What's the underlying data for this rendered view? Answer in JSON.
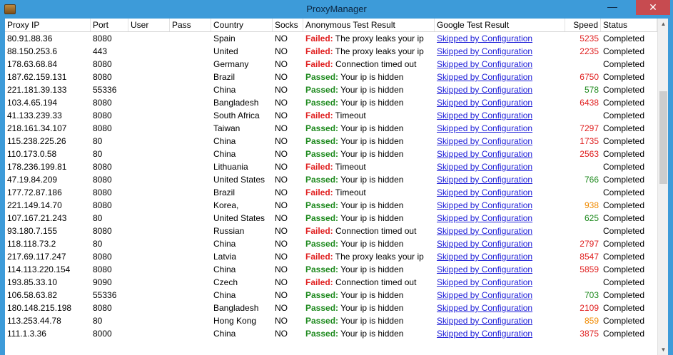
{
  "window": {
    "title": "ProxyManager",
    "minimize_glyph": "—",
    "close_glyph": "✕"
  },
  "columns": [
    "Proxy IP",
    "Port",
    "User",
    "Pass",
    "Country",
    "Socks",
    "Anonymous Test Result",
    "Google Test Result",
    "Speed",
    "Status"
  ],
  "link_text": "Skipped by Configuration",
  "colors": {
    "failed": "#e02020",
    "passed": "#1e8a1e",
    "link": "#2020d8",
    "speed_red": "#e02020",
    "speed_green": "#1e8a1e",
    "speed_orange": "#f08a00",
    "titlebar": "#3d9bd9",
    "close": "#c74b50"
  },
  "rows": [
    {
      "ip": "80.91.88.36",
      "port": "8080",
      "user": "",
      "pass": "",
      "country": "Spain",
      "socks": "NO",
      "anon_status": "Failed:",
      "anon_text": " The proxy leaks your ip",
      "google": "Skipped by Configuration",
      "speed": "5235",
      "speed_color": "red",
      "status": "Completed"
    },
    {
      "ip": "88.150.253.6",
      "port": "443",
      "user": "",
      "pass": "",
      "country": "United",
      "socks": "NO",
      "anon_status": "Failed:",
      "anon_text": " The proxy leaks your ip",
      "google": "Skipped by Configuration",
      "speed": "2235",
      "speed_color": "red",
      "status": "Completed"
    },
    {
      "ip": "178.63.68.84",
      "port": "8080",
      "user": "",
      "pass": "",
      "country": "Germany",
      "socks": "NO",
      "anon_status": "Failed:",
      "anon_text": " Connection timed out",
      "google": "Skipped by Configuration",
      "speed": "",
      "speed_color": "",
      "status": "Completed"
    },
    {
      "ip": "187.62.159.131",
      "port": "8080",
      "user": "",
      "pass": "",
      "country": "Brazil",
      "socks": "NO",
      "anon_status": "Passed:",
      "anon_text": " Your ip is hidden",
      "google": "Skipped by Configuration",
      "speed": "6750",
      "speed_color": "red",
      "status": "Completed"
    },
    {
      "ip": "221.181.39.133",
      "port": "55336",
      "user": "",
      "pass": "",
      "country": "China",
      "socks": "NO",
      "anon_status": "Passed:",
      "anon_text": " Your ip is hidden",
      "google": "Skipped by Configuration",
      "speed": "578",
      "speed_color": "green",
      "status": "Completed"
    },
    {
      "ip": "103.4.65.194",
      "port": "8080",
      "user": "",
      "pass": "",
      "country": "Bangladesh",
      "socks": "NO",
      "anon_status": "Passed:",
      "anon_text": " Your ip is hidden",
      "google": "Skipped by Configuration",
      "speed": "6438",
      "speed_color": "red",
      "status": "Completed"
    },
    {
      "ip": "41.133.239.33",
      "port": "8080",
      "user": "",
      "pass": "",
      "country": "South Africa",
      "socks": "NO",
      "anon_status": "Failed:",
      "anon_text": " Timeout",
      "google": "Skipped by Configuration",
      "speed": "",
      "speed_color": "",
      "status": "Completed"
    },
    {
      "ip": "218.161.34.107",
      "port": "8080",
      "user": "",
      "pass": "",
      "country": "Taiwan",
      "socks": "NO",
      "anon_status": "Passed:",
      "anon_text": " Your ip is hidden",
      "google": "Skipped by Configuration",
      "speed": "7297",
      "speed_color": "red",
      "status": "Completed"
    },
    {
      "ip": "115.238.225.26",
      "port": "80",
      "user": "",
      "pass": "",
      "country": "China",
      "socks": "NO",
      "anon_status": "Passed:",
      "anon_text": " Your ip is hidden",
      "google": "Skipped by Configuration",
      "speed": "1735",
      "speed_color": "red",
      "status": "Completed"
    },
    {
      "ip": "110.173.0.58",
      "port": "80",
      "user": "",
      "pass": "",
      "country": "China",
      "socks": "NO",
      "anon_status": "Passed:",
      "anon_text": " Your ip is hidden",
      "google": "Skipped by Configuration",
      "speed": "2563",
      "speed_color": "red",
      "status": "Completed"
    },
    {
      "ip": "178.236.199.81",
      "port": "8080",
      "user": "",
      "pass": "",
      "country": "Lithuania",
      "socks": "NO",
      "anon_status": "Failed:",
      "anon_text": " Timeout",
      "google": "Skipped by Configuration",
      "speed": "",
      "speed_color": "",
      "status": "Completed"
    },
    {
      "ip": "47.19.84.209",
      "port": "8080",
      "user": "",
      "pass": "",
      "country": "United States",
      "socks": "NO",
      "anon_status": "Passed:",
      "anon_text": " Your ip is hidden",
      "google": "Skipped by Configuration",
      "speed": "766",
      "speed_color": "green",
      "status": "Completed"
    },
    {
      "ip": "177.72.87.186",
      "port": "8080",
      "user": "",
      "pass": "",
      "country": "Brazil",
      "socks": "NO",
      "anon_status": "Failed:",
      "anon_text": " Timeout",
      "google": "Skipped by Configuration",
      "speed": "",
      "speed_color": "",
      "status": "Completed"
    },
    {
      "ip": "221.149.14.70",
      "port": "8080",
      "user": "",
      "pass": "",
      "country": "Korea,",
      "socks": "NO",
      "anon_status": "Passed:",
      "anon_text": " Your ip is hidden",
      "google": "Skipped by Configuration",
      "speed": "938",
      "speed_color": "orange",
      "status": "Completed"
    },
    {
      "ip": "107.167.21.243",
      "port": "80",
      "user": "",
      "pass": "",
      "country": "United States",
      "socks": "NO",
      "anon_status": "Passed:",
      "anon_text": " Your ip is hidden",
      "google": "Skipped by Configuration",
      "speed": "625",
      "speed_color": "green",
      "status": "Completed"
    },
    {
      "ip": "93.180.7.155",
      "port": "8080",
      "user": "",
      "pass": "",
      "country": "Russian",
      "socks": "NO",
      "anon_status": "Failed:",
      "anon_text": " Connection timed out",
      "google": "Skipped by Configuration",
      "speed": "",
      "speed_color": "",
      "status": "Completed"
    },
    {
      "ip": "118.118.73.2",
      "port": "80",
      "user": "",
      "pass": "",
      "country": "China",
      "socks": "NO",
      "anon_status": "Passed:",
      "anon_text": " Your ip is hidden",
      "google": "Skipped by Configuration",
      "speed": "2797",
      "speed_color": "red",
      "status": "Completed"
    },
    {
      "ip": "217.69.117.247",
      "port": "8080",
      "user": "",
      "pass": "",
      "country": "Latvia",
      "socks": "NO",
      "anon_status": "Failed:",
      "anon_text": " The proxy leaks your ip",
      "google": "Skipped by Configuration",
      "speed": "8547",
      "speed_color": "red",
      "status": "Completed"
    },
    {
      "ip": "114.113.220.154",
      "port": "8080",
      "user": "",
      "pass": "",
      "country": "China",
      "socks": "NO",
      "anon_status": "Passed:",
      "anon_text": " Your ip is hidden",
      "google": "Skipped by Configuration",
      "speed": "5859",
      "speed_color": "red",
      "status": "Completed"
    },
    {
      "ip": "193.85.33.10",
      "port": "9090",
      "user": "",
      "pass": "",
      "country": "Czech",
      "socks": "NO",
      "anon_status": "Failed:",
      "anon_text": " Connection timed out",
      "google": "Skipped by Configuration",
      "speed": "",
      "speed_color": "",
      "status": "Completed"
    },
    {
      "ip": "106.58.63.82",
      "port": "55336",
      "user": "",
      "pass": "",
      "country": "China",
      "socks": "NO",
      "anon_status": "Passed:",
      "anon_text": " Your ip is hidden",
      "google": "Skipped by Configuration",
      "speed": "703",
      "speed_color": "green",
      "status": "Completed"
    },
    {
      "ip": "180.148.215.198",
      "port": "8080",
      "user": "",
      "pass": "",
      "country": "Bangladesh",
      "socks": "NO",
      "anon_status": "Passed:",
      "anon_text": " Your ip is hidden",
      "google": "Skipped by Configuration",
      "speed": "2109",
      "speed_color": "red",
      "status": "Completed"
    },
    {
      "ip": "113.253.44.78",
      "port": "80",
      "user": "",
      "pass": "",
      "country": "Hong Kong",
      "socks": "NO",
      "anon_status": "Passed:",
      "anon_text": " Your ip is hidden",
      "google": "Skipped by Configuration",
      "speed": "859",
      "speed_color": "orange",
      "status": "Completed"
    },
    {
      "ip": "111.1.3.36",
      "port": "8000",
      "user": "",
      "pass": "",
      "country": "China",
      "socks": "NO",
      "anon_status": "Passed:",
      "anon_text": " Your ip is hidden",
      "google": "Skipped by Configuration",
      "speed": "3875",
      "speed_color": "red",
      "status": "Completed"
    }
  ]
}
